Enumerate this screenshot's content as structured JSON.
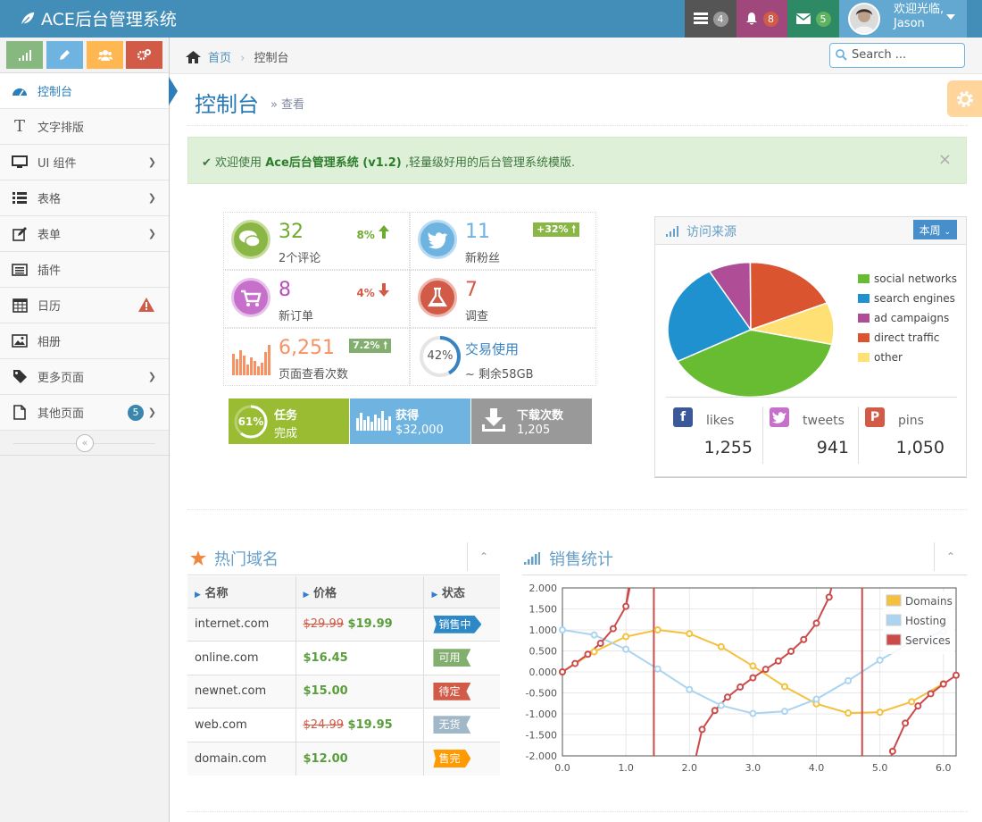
{
  "app": {
    "title": "ACE后台管理系统"
  },
  "navbar": {
    "tasks_count": "4",
    "notifications_count": "8",
    "messages_count": "5",
    "user_greeting": "欢迎光临,",
    "user_name": "Jason"
  },
  "sidebar": {
    "items": [
      {
        "label": "控制台"
      },
      {
        "label": "文字排版"
      },
      {
        "label": "UI 组件"
      },
      {
        "label": "表格"
      },
      {
        "label": "表单"
      },
      {
        "label": "插件"
      },
      {
        "label": "日历"
      },
      {
        "label": "相册"
      },
      {
        "label": "更多页面"
      },
      {
        "label": "其他页面",
        "badge": "5"
      }
    ]
  },
  "breadcrumb": {
    "home": "首页",
    "current": "控制台"
  },
  "search": {
    "placeholder": "Search ..."
  },
  "page": {
    "title": "控制台",
    "subtitle": "查看"
  },
  "alert": {
    "prefix": "欢迎使用 ",
    "brand": "Ace后台管理系统",
    "version": " (v1.2)",
    "suffix": " ,轻量级好用的后台管理系统模版."
  },
  "infoboxes": {
    "comments": {
      "value": "32",
      "label": "2个评论",
      "stat": "8%"
    },
    "followers": {
      "value": "11",
      "label": "新粉丝",
      "stat": "+32%"
    },
    "orders": {
      "value": "8",
      "label": "新订单",
      "stat": "4%"
    },
    "survey": {
      "value": "7",
      "label": "调查"
    },
    "pageviews": {
      "value": "6,251",
      "label": "页面查看次数",
      "stat": "7.2%"
    },
    "trade": {
      "percent": "42%",
      "label": "交易使用",
      "remaining": "~ 剩余58GB"
    }
  },
  "darkboxes": {
    "task": {
      "percent": "61%",
      "title": "任务",
      "sub": "完成"
    },
    "earned": {
      "title": "获得",
      "sub": "$32,000"
    },
    "downloads": {
      "title": "下载次数",
      "sub": "1,205"
    }
  },
  "traffic": {
    "title": "访问来源",
    "period": "本周",
    "legend": [
      "social networks",
      "search engines",
      "ad campaigns",
      "direct traffic",
      "other"
    ],
    "colors": [
      "#68bc31",
      "#2091cf",
      "#af4e96",
      "#da5430",
      "#fee074"
    ],
    "values": [
      38.7,
      24.5,
      8.2,
      18.6,
      10.0
    ],
    "social": {
      "likes_label": "likes",
      "likes": "1,255",
      "tweets_label": "tweets",
      "tweets": "941",
      "pins_label": "pins",
      "pins": "1,050"
    }
  },
  "domains": {
    "title": "热门域名",
    "headers": [
      "名称",
      "价格",
      "状态"
    ],
    "rows": [
      {
        "name": "internet.com",
        "old": "$29.99",
        "price": "$19.99",
        "status": "销售中",
        "color": "#2e88c6"
      },
      {
        "name": "online.com",
        "old": "",
        "price": "$16.45",
        "status": "可用",
        "color": "#82af6f"
      },
      {
        "name": "newnet.com",
        "old": "",
        "price": "$15.00",
        "status": "待定",
        "color": "#d15b47"
      },
      {
        "name": "web.com",
        "old": "$24.99",
        "price": "$19.95",
        "status": "无货",
        "color": "#a0b7c8"
      },
      {
        "name": "domain.com",
        "old": "",
        "price": "$12.00",
        "status": "售完",
        "color": "#ff9a00"
      }
    ]
  },
  "sales": {
    "title": "销售统计"
  },
  "chart_data": {
    "type": "line",
    "title": "销售统计",
    "xlim": [
      0,
      6.2
    ],
    "ylim": [
      -2,
      2
    ],
    "xticks": [
      "0.0",
      "1.0",
      "2.0",
      "3.0",
      "4.0",
      "5.0",
      "6.0"
    ],
    "yticks": [
      "2.000",
      "1.500",
      "1.000",
      "0.500",
      "0.000",
      "-0.500",
      "-1.000",
      "-1.500",
      "-2.000"
    ],
    "grid": true,
    "legend_position": "top-right",
    "series": [
      {
        "name": "Domains",
        "color": "#f4c03d",
        "x": [
          0,
          0.5,
          1,
          1.5,
          2,
          2.5,
          3,
          3.5,
          4,
          4.5,
          5,
          5.5,
          6
        ],
        "y": [
          0,
          0.48,
          0.84,
          1.0,
          0.91,
          0.6,
          0.14,
          -0.35,
          -0.76,
          -0.98,
          -0.96,
          -0.71,
          -0.28
        ]
      },
      {
        "name": "Hosting",
        "color": "#aad4f0",
        "x": [
          0,
          0.5,
          1,
          1.5,
          2,
          2.5,
          3,
          3.5,
          4,
          4.5,
          5,
          5.5,
          6
        ],
        "y": [
          1.0,
          0.88,
          0.54,
          0.07,
          -0.42,
          -0.8,
          -0.99,
          -0.94,
          -0.65,
          -0.21,
          0.28,
          0.71,
          0.96
        ]
      },
      {
        "name": "Services",
        "color": "#cb4b4b",
        "x": [
          0,
          0.2,
          0.4,
          0.6,
          0.8,
          1.0,
          2.2,
          2.4,
          2.6,
          2.8,
          3.0,
          3.2,
          3.4,
          3.6,
          3.8,
          4.0,
          4.2,
          5.2,
          5.4,
          5.6,
          5.8,
          6.0,
          6.2
        ],
        "y": [
          0,
          0.2,
          0.42,
          0.68,
          1.03,
          1.56,
          -1.37,
          -0.92,
          -0.6,
          -0.36,
          -0.14,
          0.06,
          0.26,
          0.49,
          0.77,
          1.16,
          1.78,
          -1.89,
          -1.22,
          -0.81,
          -0.52,
          -0.29,
          -0.08
        ]
      }
    ]
  }
}
